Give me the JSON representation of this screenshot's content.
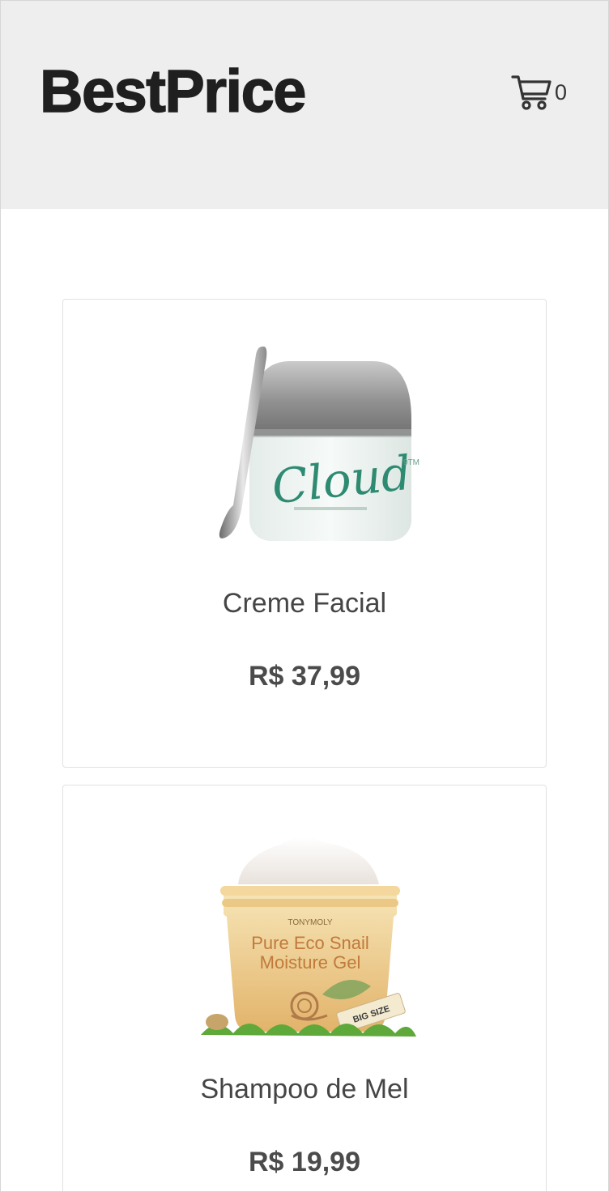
{
  "header": {
    "brand": "BestPrice",
    "cart_icon": "shopping-cart-icon",
    "cart_count": "0"
  },
  "products": [
    {
      "name": "Creme Facial",
      "price": "R$ 37,99",
      "image": "cloud-face-cream-jar",
      "image_text": "Cloud"
    },
    {
      "name": "Shampoo de Mel",
      "price": "R$ 19,99",
      "image": "snail-moisture-gel-jar",
      "image_text": [
        "TONYMOLY",
        "Pure Eco Snail",
        "Moisture Gel",
        "BIG SIZE"
      ]
    }
  ],
  "colors": {
    "header_bg": "#eeeeee",
    "brand_text": "#1f1f1f",
    "card_border": "#e2e2e2",
    "text": "#454545"
  }
}
